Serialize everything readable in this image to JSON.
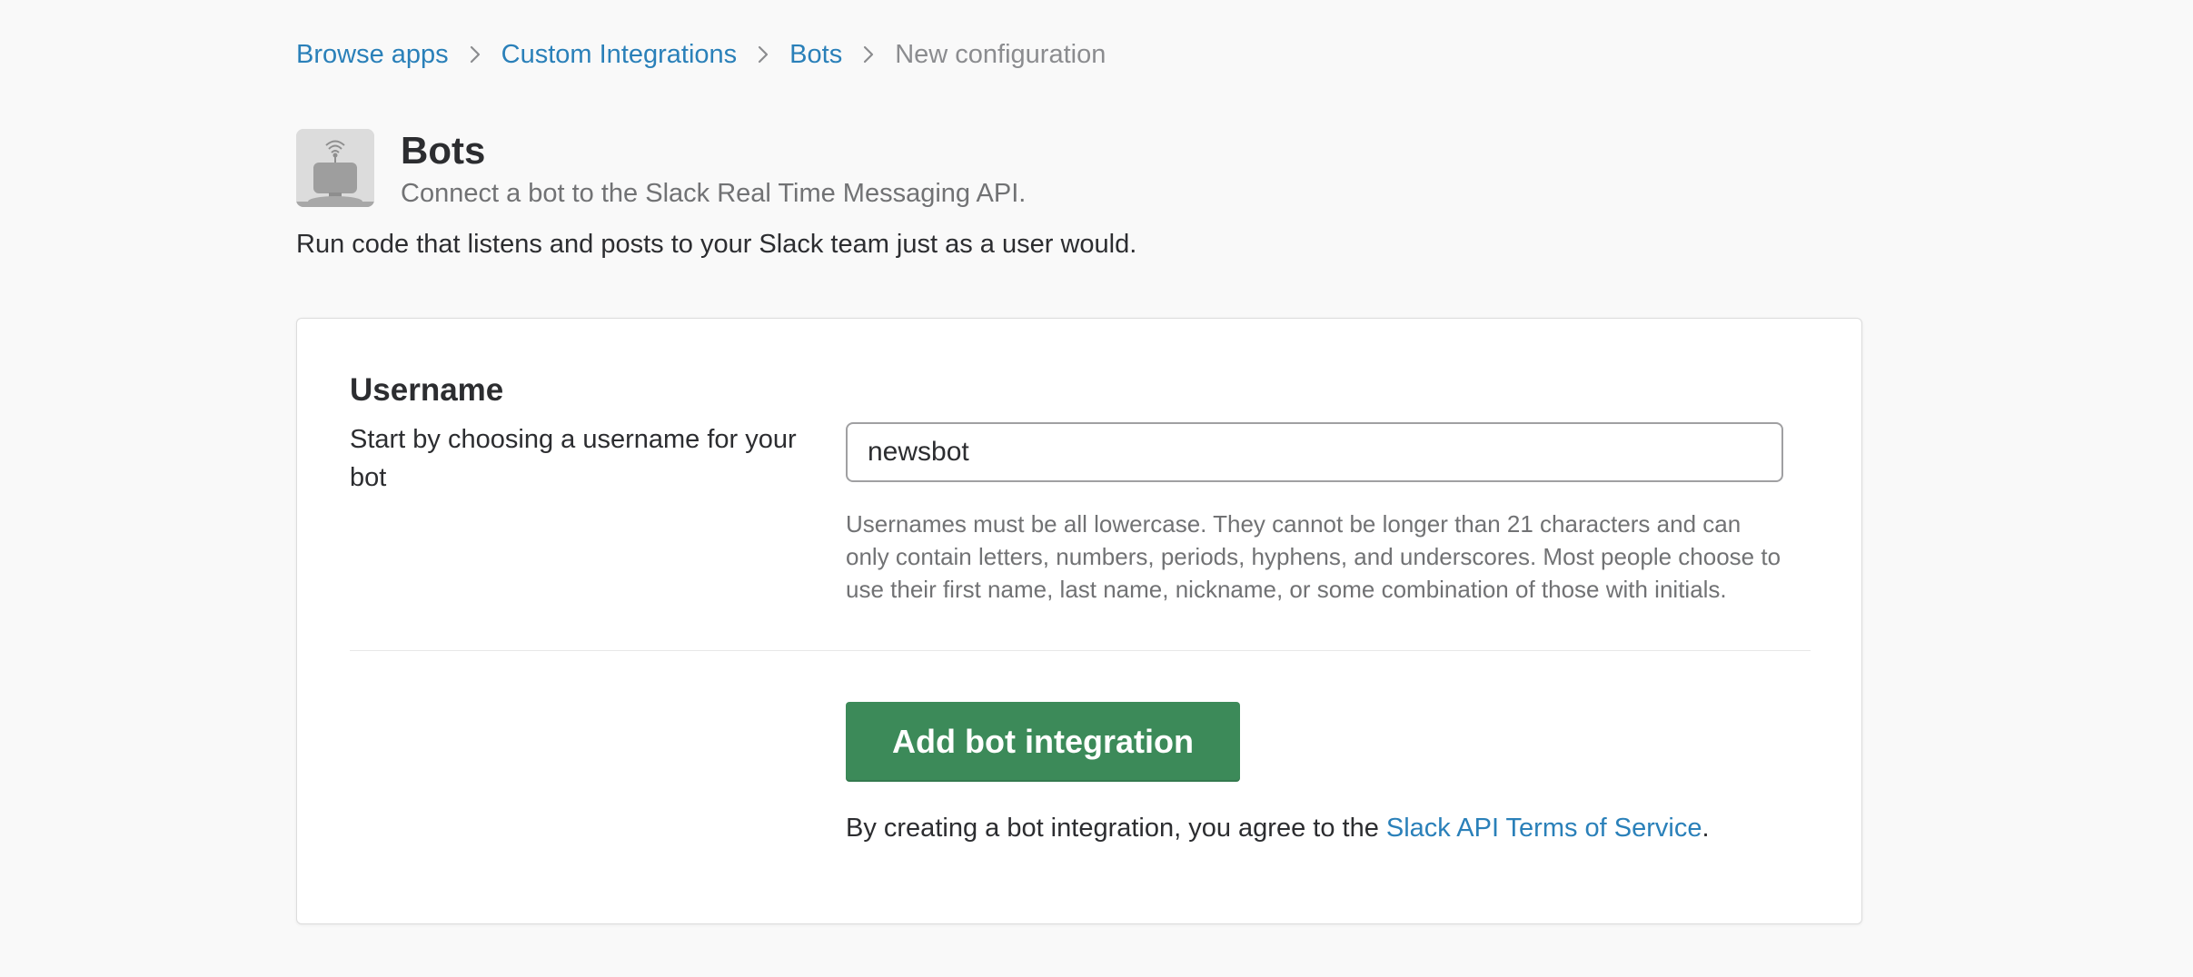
{
  "breadcrumb": {
    "items": [
      "Browse apps",
      "Custom Integrations",
      "Bots"
    ],
    "current": "New configuration"
  },
  "app": {
    "title": "Bots",
    "tagline": "Connect a bot to the Slack Real Time Messaging API.",
    "description": "Run code that listens and posts to your Slack team just as a user would.",
    "icon": "bot-icon"
  },
  "form": {
    "section_title": "Username",
    "field_help": "Start by choosing a username for your bot",
    "username_value": "newsbot",
    "hint": "Usernames must be all lowercase. They cannot be longer than 21 characters and can only contain letters, numbers, periods, hyphens, and underscores. Most people choose to use their first name, last name, nickname, or some combination of those with initials.",
    "submit_label": "Add bot integration",
    "terms_prefix": "By creating a bot integration, you agree to the ",
    "terms_link": "Slack API Terms of Service",
    "terms_suffix": "."
  },
  "colors": {
    "link": "#2a80b9",
    "button": "#3c8a59",
    "background": "#f9f9f9"
  }
}
